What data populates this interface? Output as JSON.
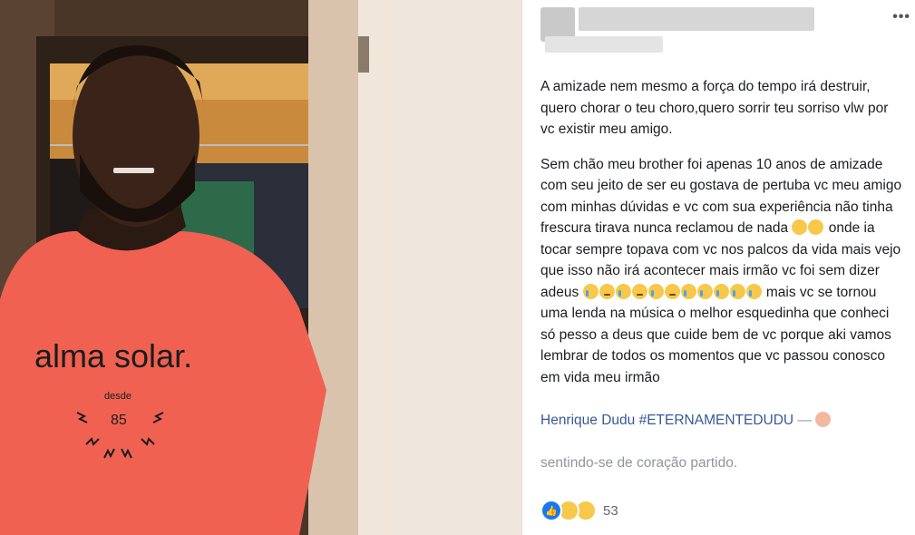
{
  "post": {
    "paragraph1": "A amizade nem mesmo a força do tempo irá destruir, quero chorar o teu choro,quero sorrir teu sorriso vlw por vc existir meu amigo.",
    "paragraph2_part1": "Sem chão meu brother foi apenas 10 anos de amizade com seu jeito de ser eu gostava de pertuba vc meu amigo com minhas dúvidas e vc com sua experiência não tinha frescura tirava nunca reclamou de nada ",
    "paragraph2_part2": " onde ia tocar sempre topava com vc nos palcos da vida mais vejo que isso não irá acontecer mais irmão vc foi sem dizer adeus ",
    "paragraph2_part3": " mais vc se tornou uma lenda na música o melhor esquedinha que conheci só pesso a deus que cuide bem de vc porque aki vamos lembrar de todos os momentos que vc passou conosco em vida meu irmão",
    "tag": "Henrique Dudu",
    "hashtag": "#ETERNAMENTEDUDU",
    "dash": " — ",
    "feeling": "sentindo-se de coração partido."
  },
  "reactions": {
    "count": "53",
    "icons": [
      "like-icon",
      "sad-icon",
      "wow-icon"
    ]
  },
  "photo": {
    "shirt_text": "alma solar.",
    "shirt_small": "desde",
    "shirt_number": "85"
  },
  "colors": {
    "link": "#385898",
    "shirt": "#f06152",
    "like": "#1877f2"
  }
}
